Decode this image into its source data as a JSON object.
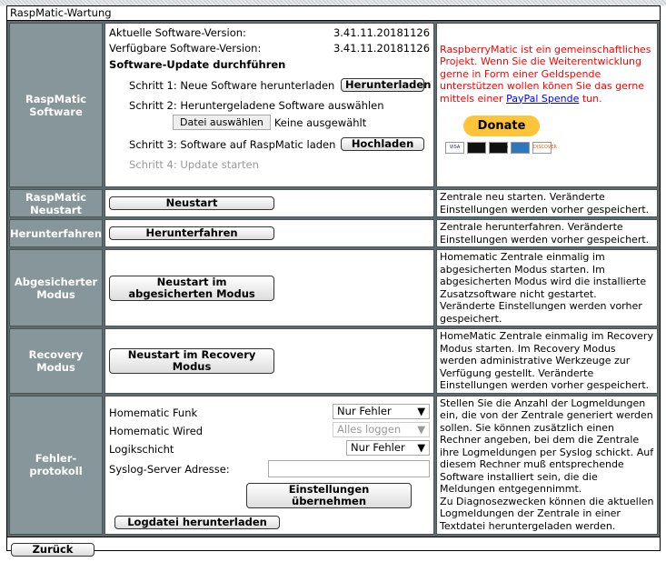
{
  "window": {
    "title": "RaspMatic-Wartung"
  },
  "software": {
    "label": "RaspMatic Software",
    "current_label": "Aktuelle Software-Version:",
    "current_value": "3.41.11.20181126",
    "available_label": "Verfügbare Software-Version:",
    "available_value": "3.41.11.20181126",
    "update_heading": "Software-Update durchführen",
    "step1": "Schritt 1: Neue Software herunterladen",
    "step1_button": "Herunterladen",
    "step2": "Schritt 2: Heruntergeladene Software auswählen",
    "file_button": "Datei auswählen",
    "file_status": "Keine ausgewählt",
    "step3": "Schritt 3: Software auf RaspMatic laden",
    "step3_button": "Hochladen",
    "step4": "Schritt 4: Update starten",
    "donate_text": "RaspberryMatic ist ein gemeinschaftliches Projekt. Wenn Sie die Weiterentwicklung gerne in Form einer Geldspende unterstützen wollen könen Sie das gerne mittels einer",
    "donate_link": "PayPal Spende",
    "donate_suffix": " tun.",
    "donate_button": "Donate",
    "cards": [
      "VISA",
      "MC",
      "Maestro",
      "AMEX",
      "DISCOVER"
    ]
  },
  "restart": {
    "label": "RaspMatic Neustart",
    "button": "Neustart",
    "desc": "Zentrale neu starten. Veränderte Einstellungen werden vorher gespeichert."
  },
  "shutdown": {
    "label": "Herunterfahren",
    "button": "Herunterfahren",
    "desc": "Zentrale herunterfahren. Veränderte Einstellungen werden vorher gespeichert."
  },
  "safemode": {
    "label": "Abgesicherter Modus",
    "button": "Neustart im abgesicherten Modus",
    "desc": "Homematic Zentrale einmalig im abgesicherten Modus starten. Im abgesicherten Modus wird die installierte Zusatzsoftware nicht gestartet. Veränderte Einstellungen werden vorher gespeichert."
  },
  "recovery": {
    "label": "Recovery Modus",
    "button": "Neustart im Recovery Modus",
    "desc": "HomeMatic Zentrale einmalig im Recovery Modus starten. Im Recovery Modus werden administrative Werkzeuge zur Verfügung gestellt. Veränderte Einstellungen werden vorher gespeichert."
  },
  "log": {
    "label": "Fehler-protokoll",
    "funk_label": "Homematic Funk",
    "funk_value": "Nur Fehler",
    "wired_label": "Homematic Wired",
    "wired_value": "Alles loggen",
    "logic_label": "Logikschicht",
    "logic_value": "Nur Fehler",
    "syslog_label": "Syslog-Server Adresse:",
    "syslog_value": "",
    "apply_button": "Einstellungen übernehmen",
    "download_button": "Logdatei herunterladen",
    "desc": "Stellen Sie die Anzahl der Logmeldungen ein, die von der Zentrale generiert werden sollen. Sie können zusätzlich einen Rechner angeben, bei dem die Zentrale ihre Logmeldungen per Syslog schickt. Auf diesem Rechner muß entsprechende Software installiert sein, die die Meldungen entgegennimmt.",
    "desc2": "Zu Diagnosezwecken können die aktuellen Logmeldungen der Zentrale in einer Textdatei heruntergeladen werden."
  },
  "footer": {
    "back_button": "Zurück"
  },
  "colors": {
    "label_bg": "#86969a",
    "donate_text": "#ff0000",
    "link": "#0000ee",
    "donate_button": "#ffc439"
  }
}
